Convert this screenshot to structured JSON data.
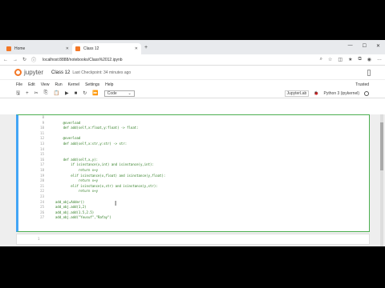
{
  "browser": {
    "tabs": [
      {
        "label": "Home",
        "active": false,
        "favicon_color": "#f37726"
      },
      {
        "label": "Class 12",
        "active": true,
        "favicon_color": "#f37726"
      }
    ],
    "new_tab": "+",
    "url": "localhost:8888/notebooks/Class%2012.ipynb"
  },
  "jupyter": {
    "logo": "jupyter",
    "notebook_title": "Class 12",
    "checkpoint": "Last Checkpoint: 34 minutes ago",
    "menu": [
      "File",
      "Edit",
      "View",
      "Run",
      "Kernel",
      "Settings",
      "Help"
    ],
    "trusted": "Trusted",
    "cell_type": "Code",
    "jupyterlab_btn": "JupyterLab",
    "kernel_name": "Python 3 (ipykernel)"
  },
  "cell": {
    "line_numbers": [
      "8",
      "9",
      "10",
      "11",
      "12",
      "13",
      "14",
      "15",
      "16",
      "17",
      "18",
      "19",
      "20",
      "21",
      "22",
      "23",
      "24",
      "25",
      "26",
      "27"
    ],
    "code_lines": [
      "",
      "    @overload",
      "    def add(self,x:float,y:float) -> float:",
      "",
      "    @overload",
      "    def add(self,x:str,y:str) -> str:",
      "",
      "",
      "    def add(self,x,y):",
      "        if isinstance(x,int) and isinstance(y,int):",
      "            return x+y",
      "        elif isinstance(x,float) and isinstance(y,float):",
      "            return x+y",
      "        elif isinstance(x,str) and isinstance(y,str):",
      "            return x+y",
      "",
      "add_obj=Adder()",
      "add_obj.add(1,2)",
      "add_obj.add(1.5,2.5)",
      "add_obj.add(\"Yousuf\",\"Rafay\")"
    ],
    "next_cell_number": "1"
  }
}
